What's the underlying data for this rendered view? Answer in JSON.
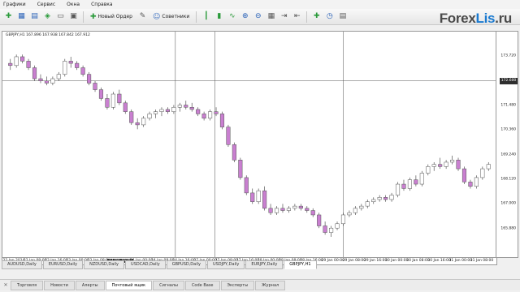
{
  "menu": [
    "Графики",
    "Сервис",
    "Окна",
    "Справка"
  ],
  "toolbar": {
    "new_order": "Новый Ордер",
    "advisors": "Советники"
  },
  "logo": {
    "main": "Forex",
    "accent": "Lis",
    "suffix": ".ru"
  },
  "chart": {
    "header": "GBPJPY,H1  167.896 167.938 167.842 167.912",
    "current_price": "172.600",
    "price_labels": [
      "173.720",
      "172.600",
      "171.480",
      "170.360",
      "169.240",
      "168.120",
      "167.000",
      "165.880"
    ],
    "time_labels": [
      "22 Jan 2014",
      "22 Jan 08:00",
      "22 Jan 16:00",
      "23 Jan 00:00",
      "23 Jan 08:00",
      "23 Jan 16:00",
      "24 Jan 00:00",
      "24 Jan 08:00",
      "24 Jan 16:00",
      "27 Jan 00:00",
      "27 Jan 08:00",
      "27 Jan 16:00",
      "28 Jan 00:00",
      "28 Jan 08:00",
      "28 Jan 16:00",
      "29 Jan 00:00",
      "29 Jan 08:00",
      "29 Jan 16:00",
      "30 Jan 00:00",
      "30 Jan 08:00",
      "30 Jan 16:00",
      "31 Jan 00:00",
      "31 Jan 08:00"
    ],
    "highlight_time": "23 Jan 16:00",
    "colors": {
      "bull": "#ffffff",
      "bear": "#c97fd0",
      "wick": "#555555"
    }
  },
  "symbol_tabs": [
    "AUDUSD,Daily",
    "EURUSD,Daily",
    "NZDUSD,Daily",
    "USDCAD,Daily",
    "GBPUSD,Daily",
    "USDJPY,Daily",
    "EURJPY,Daily",
    "GBPJPY,H1"
  ],
  "active_symbol": "GBPJPY,H1",
  "bottom_tabs": [
    "Торговля",
    "Новости",
    "Алерты",
    "Почтовый ящик",
    "Сигналы",
    "Code Base",
    "Эксперты",
    "Журнал"
  ],
  "active_bottom_tab": "Почтовый ящик",
  "chart_data": {
    "type": "candlestick",
    "x": [
      1,
      2,
      3,
      4,
      5,
      6,
      7,
      8,
      9,
      10,
      11,
      12,
      13,
      14,
      15,
      16,
      17,
      18,
      19,
      20,
      21,
      22,
      23,
      24,
      25,
      26,
      27,
      28,
      29,
      30,
      31,
      32,
      33,
      34,
      35,
      36,
      37,
      38,
      39,
      40,
      41,
      42,
      43,
      44,
      45,
      46,
      47,
      48,
      49,
      50,
      51,
      52,
      53,
      54,
      55,
      56,
      57,
      58,
      59,
      60,
      61,
      62,
      63,
      64,
      65,
      66,
      67,
      68,
      69,
      70,
      71,
      72,
      73,
      74,
      75,
      76,
      77,
      78,
      79,
      80
    ],
    "candles": [
      [
        173.4,
        173.6,
        173.1,
        173.3
      ],
      [
        173.3,
        173.8,
        173.2,
        173.7
      ],
      [
        173.7,
        173.8,
        173.4,
        173.5
      ],
      [
        173.5,
        173.6,
        173.1,
        173.2
      ],
      [
        173.2,
        173.3,
        172.6,
        172.7
      ],
      [
        172.7,
        172.9,
        172.5,
        172.6
      ],
      [
        172.6,
        172.8,
        172.4,
        172.5
      ],
      [
        172.5,
        172.8,
        172.4,
        172.7
      ],
      [
        172.7,
        173.0,
        172.6,
        172.9
      ],
      [
        172.9,
        173.6,
        172.8,
        173.5
      ],
      [
        173.5,
        173.7,
        173.2,
        173.4
      ],
      [
        173.4,
        173.5,
        173.1,
        173.2
      ],
      [
        173.2,
        173.3,
        172.8,
        172.9
      ],
      [
        172.9,
        173.0,
        172.4,
        172.5
      ],
      [
        172.5,
        172.6,
        172.1,
        172.2
      ],
      [
        172.2,
        172.3,
        171.7,
        171.8
      ],
      [
        171.8,
        172.0,
        171.3,
        171.4
      ],
      [
        171.4,
        172.1,
        171.3,
        172.0
      ],
      [
        172.0,
        172.2,
        171.5,
        171.6
      ],
      [
        171.6,
        171.7,
        171.1,
        171.2
      ],
      [
        171.2,
        171.3,
        170.6,
        170.7
      ],
      [
        170.7,
        170.9,
        170.4,
        170.6
      ],
      [
        170.6,
        171.0,
        170.5,
        170.9
      ],
      [
        170.9,
        171.2,
        170.8,
        171.1
      ],
      [
        171.1,
        171.3,
        170.9,
        171.2
      ],
      [
        171.2,
        171.4,
        171.0,
        171.3
      ],
      [
        171.3,
        171.4,
        171.1,
        171.2
      ],
      [
        171.2,
        171.5,
        171.1,
        171.4
      ],
      [
        171.4,
        171.6,
        171.2,
        171.5
      ],
      [
        171.5,
        171.7,
        171.3,
        171.4
      ],
      [
        171.4,
        171.6,
        171.2,
        171.3
      ],
      [
        171.3,
        171.4,
        171.0,
        171.1
      ],
      [
        171.1,
        171.2,
        170.8,
        170.9
      ],
      [
        170.9,
        171.3,
        170.8,
        171.2
      ],
      [
        171.2,
        171.4,
        171.0,
        171.1
      ],
      [
        171.1,
        171.2,
        170.4,
        170.5
      ],
      [
        170.5,
        170.6,
        169.6,
        169.7
      ],
      [
        169.7,
        169.8,
        168.9,
        169.0
      ],
      [
        169.0,
        169.1,
        168.1,
        168.2
      ],
      [
        168.2,
        168.3,
        167.4,
        167.5
      ],
      [
        167.5,
        167.7,
        167.0,
        167.1
      ],
      [
        167.1,
        167.7,
        167.0,
        167.6
      ],
      [
        167.6,
        167.8,
        166.7,
        166.8
      ],
      [
        166.8,
        167.0,
        166.5,
        166.6
      ],
      [
        166.6,
        166.9,
        166.5,
        166.8
      ],
      [
        166.8,
        167.0,
        166.6,
        166.7
      ],
      [
        166.7,
        166.9,
        166.6,
        166.8
      ],
      [
        166.8,
        167.0,
        166.7,
        166.9
      ],
      [
        166.9,
        167.0,
        166.7,
        166.8
      ],
      [
        166.8,
        166.9,
        166.6,
        166.7
      ],
      [
        166.7,
        166.8,
        166.4,
        166.5
      ],
      [
        166.5,
        166.6,
        165.9,
        166.0
      ],
      [
        166.0,
        166.2,
        165.6,
        165.7
      ],
      [
        165.7,
        166.0,
        165.5,
        165.9
      ],
      [
        165.9,
        166.2,
        165.8,
        166.1
      ],
      [
        166.1,
        166.6,
        166.0,
        166.5
      ],
      [
        166.5,
        166.7,
        166.4,
        166.6
      ],
      [
        166.6,
        166.9,
        166.5,
        166.8
      ],
      [
        166.8,
        167.0,
        166.7,
        166.9
      ],
      [
        166.9,
        167.2,
        166.8,
        167.1
      ],
      [
        167.1,
        167.3,
        167.0,
        167.2
      ],
      [
        167.2,
        167.4,
        167.1,
        167.3
      ],
      [
        167.3,
        167.4,
        167.1,
        167.2
      ],
      [
        167.2,
        167.5,
        167.1,
        167.4
      ],
      [
        167.4,
        168.0,
        167.3,
        167.9
      ],
      [
        167.9,
        168.1,
        167.6,
        167.7
      ],
      [
        167.7,
        168.2,
        167.6,
        168.1
      ],
      [
        168.1,
        168.3,
        167.8,
        167.9
      ],
      [
        167.9,
        168.5,
        167.8,
        168.4
      ],
      [
        168.4,
        168.8,
        168.3,
        168.7
      ],
      [
        168.7,
        168.9,
        168.5,
        168.8
      ],
      [
        168.8,
        169.1,
        168.6,
        168.7
      ],
      [
        168.7,
        169.0,
        168.6,
        168.9
      ],
      [
        168.9,
        169.2,
        168.8,
        169.0
      ],
      [
        169.0,
        169.1,
        168.5,
        168.6
      ],
      [
        168.6,
        168.7,
        167.9,
        168.0
      ],
      [
        168.0,
        168.1,
        167.7,
        167.8
      ],
      [
        167.8,
        168.3,
        167.7,
        168.2
      ],
      [
        168.2,
        168.7,
        168.1,
        168.6
      ],
      [
        168.6,
        168.9,
        168.5,
        168.8
      ]
    ],
    "ylim": [
      164.8,
      174.4
    ]
  }
}
